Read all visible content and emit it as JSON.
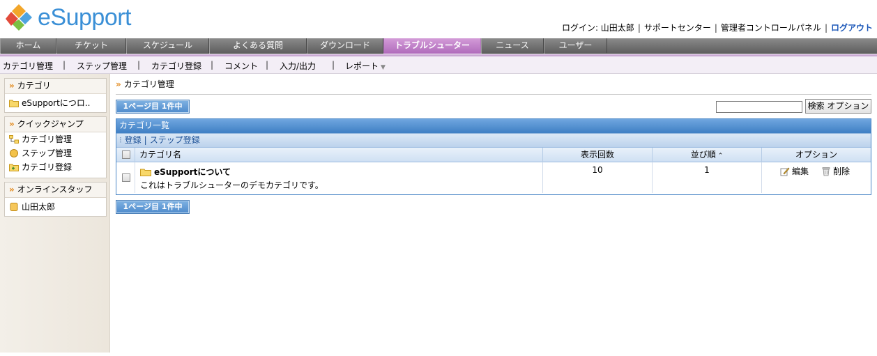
{
  "header": {
    "logo_text": "eSupport",
    "login_label": "ログイン: 山田太郎",
    "support_center": "サポートセンター",
    "admin_panel": "管理者コントロールパネル",
    "logout": "ログアウト",
    "separator": "|"
  },
  "main_nav": [
    {
      "label": "ホーム"
    },
    {
      "label": "チケット"
    },
    {
      "label": "スケジュール"
    },
    {
      "label": "よくある質問"
    },
    {
      "label": "ダウンロード"
    },
    {
      "label": "トラブルシューター",
      "active": true
    },
    {
      "label": "ニュース"
    },
    {
      "label": "ユーザー"
    }
  ],
  "sub_nav": [
    {
      "label": "カテゴリ管理"
    },
    {
      "label": "ステップ管理"
    },
    {
      "label": "カテゴリ登録"
    },
    {
      "label": "コメント"
    },
    {
      "label": "入力/出力"
    },
    {
      "label": "レポート"
    }
  ],
  "sub_nav_sep": "|",
  "sub_nav_caret": "▼",
  "sidebar": {
    "raquo": "»",
    "category": {
      "title": "カテゴリ",
      "items": [
        "eSupportにつロ.."
      ]
    },
    "quick_jump": {
      "title": "クイックジャンプ",
      "items": [
        "カテゴリ管理",
        "ステップ管理",
        "カテゴリ登録"
      ]
    },
    "online_staff": {
      "title": "オンラインスタッフ",
      "items": [
        "山田太郎"
      ]
    }
  },
  "content": {
    "breadcrumb": "カテゴリ管理",
    "pager_text": "1ページ目 1件中",
    "search_button": "検索 オプション",
    "search_value": "",
    "panel_title": "カテゴリ一覧",
    "actions": {
      "register": "登録",
      "sep": "|",
      "step_register": "ステップ登録"
    },
    "columns": {
      "name": "カテゴリ名",
      "views": "表示回数",
      "order": "並び順",
      "options": "オプション"
    },
    "sort_icon": "⌃",
    "rows": [
      {
        "name": "eSupportについて",
        "description": "これはトラブルシューターのデモカテゴリです。",
        "views": "10",
        "order": "1",
        "edit": "編集",
        "delete": "削除"
      }
    ]
  },
  "colors": {
    "accent": "#3a8fd6",
    "nav_active": "#b06bbb",
    "panel_blue": "#4a86c6",
    "raquo_orange": "#e28a1e"
  }
}
